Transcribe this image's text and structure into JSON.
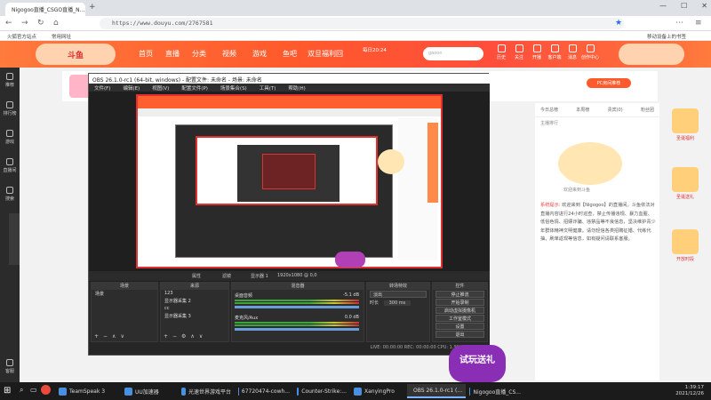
{
  "browser": {
    "tab_title": "Nigogoo直播_CSGO直播_N...",
    "new_tab": "+",
    "url": "https://www.douyu.com/2767581",
    "bookmarks": [
      "火狐官方站点",
      "常用网址"
    ],
    "bookmarks_right": "移动设备上的书签"
  },
  "douyu": {
    "nav": [
      "首页",
      "直播",
      "分类",
      "视频",
      "游戏",
      "鱼吧",
      "双旦福利回"
    ],
    "promo_text": "每日20:24",
    "search_placeholder": "gaoon",
    "header_icons": [
      "历史",
      "关注",
      "开播",
      "客户端",
      "消息",
      "创作中心"
    ],
    "side_items": [
      "推荐",
      "排行榜",
      "游戏",
      "直播间",
      "搜索",
      "客服"
    ],
    "right_tabs": [
      "今日总榜",
      "本周榜",
      "贵宾(0)",
      "粉丝团"
    ],
    "room_btn": "PC房间推荐",
    "rank_label": "主播排行",
    "sys_label": "系统提示:",
    "sys_text": "欢迎来到【Nigogoo】的直播间。斗鱼依法对直播内容进行24小时巡查，禁止传播违规、暴力血腥、低俗色情、招嫖诈骗、违禁品等不良信息，坚决维护青少年群体精神文明健康。请勿轻信各类招聘征婚、代练代抽、刷单返现等信息，如有疑问请联系客服。",
    "promo_items": [
      "圣诞福利",
      "圣诞送礼",
      "开放时段"
    ],
    "dialog_text": "欢迎来到斗鱼"
  },
  "obs": {
    "title": "OBS 26.1.0-rc1 (64-bit, windows) - 配置文件: 未命名 - 场景: 未命名",
    "menu": [
      "文件(F)",
      "编辑(E)",
      "视图(V)",
      "配置文件(P)",
      "场景集合(S)",
      "工具(T)",
      "帮助(H)"
    ],
    "toolbar": [
      "属性",
      "滤镜",
      "显示器 1",
      "1920x1080 @ 0,0"
    ],
    "docks": {
      "scenes": "场景",
      "sources": "来源",
      "mixer": "混音器",
      "transitions": "转场特效",
      "controls": "控件"
    },
    "scene_item": "场景",
    "source_items": [
      "123",
      "显示器采集 2",
      "cc",
      "显示器采集 3"
    ],
    "mixer_rows": [
      {
        "name": "桌面音频",
        "db": "-5.1 dB"
      },
      {
        "name": "麦克风/Aux",
        "db": "0.0 dB"
      }
    ],
    "transition": "淡出",
    "duration_label": "时长",
    "duration": "300 ms",
    "controls": [
      "停止推流",
      "开始录制",
      "启动虚拟摄像机",
      "工作室模式",
      "设置",
      "退出"
    ],
    "status": "LIVE: 00:00:00   REC: 00:00:00   CPU: 1.9%, 30.00 fps"
  },
  "taskbar": {
    "start": "⊞",
    "items": [
      "TeamSpeak 3",
      "UU加速器",
      "光速世界游戏平台",
      "67720474-cowh...",
      "Counter-Strike:...",
      "XanyingPro",
      "OBS 26.1.0-rc1 (...",
      "Nigogoo直播_CS..."
    ],
    "time": "1:39:17",
    "date": "2021/12/26"
  },
  "corner_badge": "试玩送礼"
}
